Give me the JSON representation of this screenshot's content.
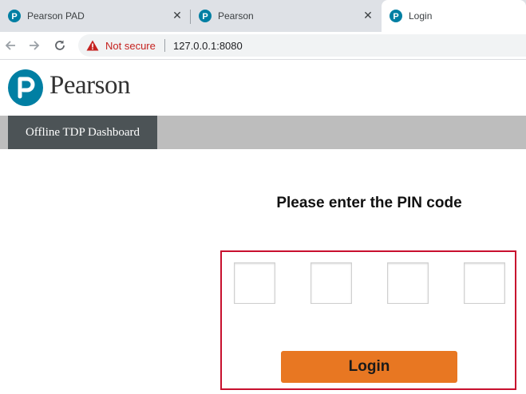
{
  "browser": {
    "tabs": [
      {
        "title": "Pearson PAD",
        "active": false
      },
      {
        "title": "Pearson",
        "active": false
      },
      {
        "title": "Login",
        "active": true
      }
    ],
    "security_label": "Not secure",
    "url": "127.0.0.1:8080"
  },
  "header": {
    "logo_text": "Pearson"
  },
  "nav": {
    "items": [
      {
        "label": "Offline TDP Dashboard"
      }
    ]
  },
  "login": {
    "title": "Please enter the PIN code",
    "pin_digits": [
      "",
      "",
      "",
      ""
    ],
    "button_label": "Login"
  },
  "colors": {
    "brand_blue": "#007fa3",
    "button_orange": "#e87722",
    "highlight_red": "#c8102e",
    "nav_dark": "#4c5356",
    "nav_bar": "#bdbdbd"
  }
}
